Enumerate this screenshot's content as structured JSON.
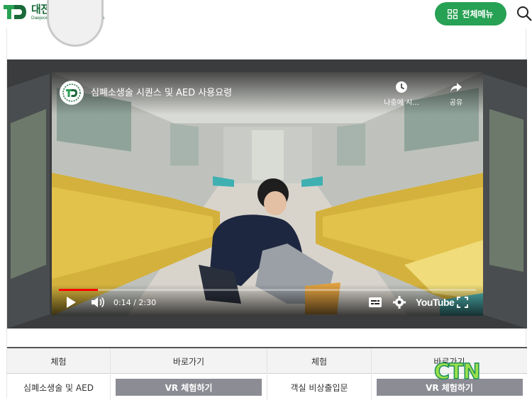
{
  "header": {
    "logo_ko": "대전교통공사",
    "logo_en": "Daejeon Transportation Corporation",
    "menu_label": "전체메뉴"
  },
  "video": {
    "title": "심폐소생술 시퀀스 및 AED 사용요령",
    "watch_later": "나중에 시...",
    "share": "공유",
    "time": "0:14 / 2:30",
    "progress_fraction": 0.093,
    "platform": "YouTube"
  },
  "table": {
    "headers": [
      "체험",
      "바로가기",
      "체험",
      "바로가기"
    ],
    "rows": [
      [
        "심폐소생술 및 AED",
        "VR 체험하기",
        "객실 비상출입문",
        "VR 체험하기"
      ]
    ]
  },
  "watermark": "CTN",
  "colors": {
    "brand_green": "#27a153",
    "logo_green": "#1b6b3a",
    "progress_red": "#ff0000",
    "vr_button": "#8c8c95"
  }
}
